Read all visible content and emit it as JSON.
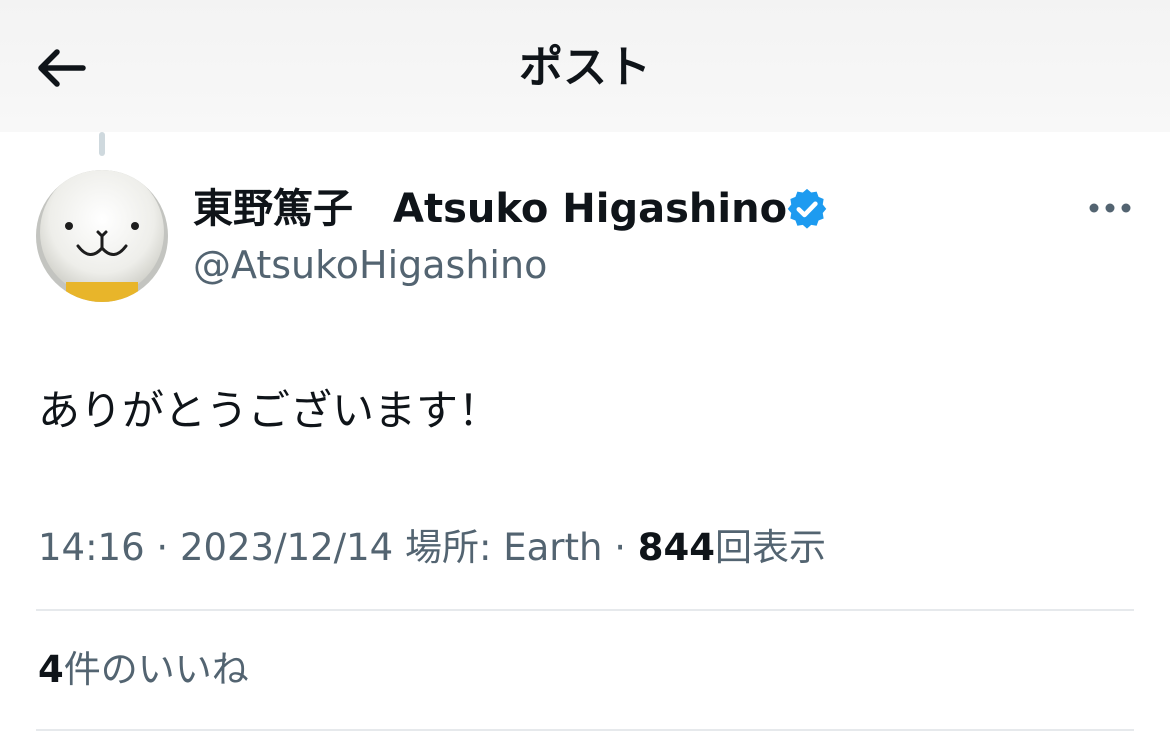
{
  "header": {
    "title": "ポスト",
    "back_icon": "arrow-left-icon"
  },
  "post": {
    "display_name": "東野篤子　Atsuko Higashino",
    "handle": "@AtsukoHigashino",
    "verified_icon": "verified-badge-icon",
    "verified_color": "#1d9bf0",
    "more_icon": "more-horizontal-icon",
    "text": "ありがとうございます！",
    "time": "14:16",
    "separator": "·",
    "date": "2023/12/14",
    "location_label": "場所: Earth",
    "views_count": "844",
    "views_label": "回表示"
  },
  "engagement": {
    "likes_count": "4",
    "likes_label": "件のいいね"
  },
  "colors": {
    "text_primary": "#0f1419",
    "text_secondary": "#536471",
    "divider": "#e6e9ec"
  }
}
